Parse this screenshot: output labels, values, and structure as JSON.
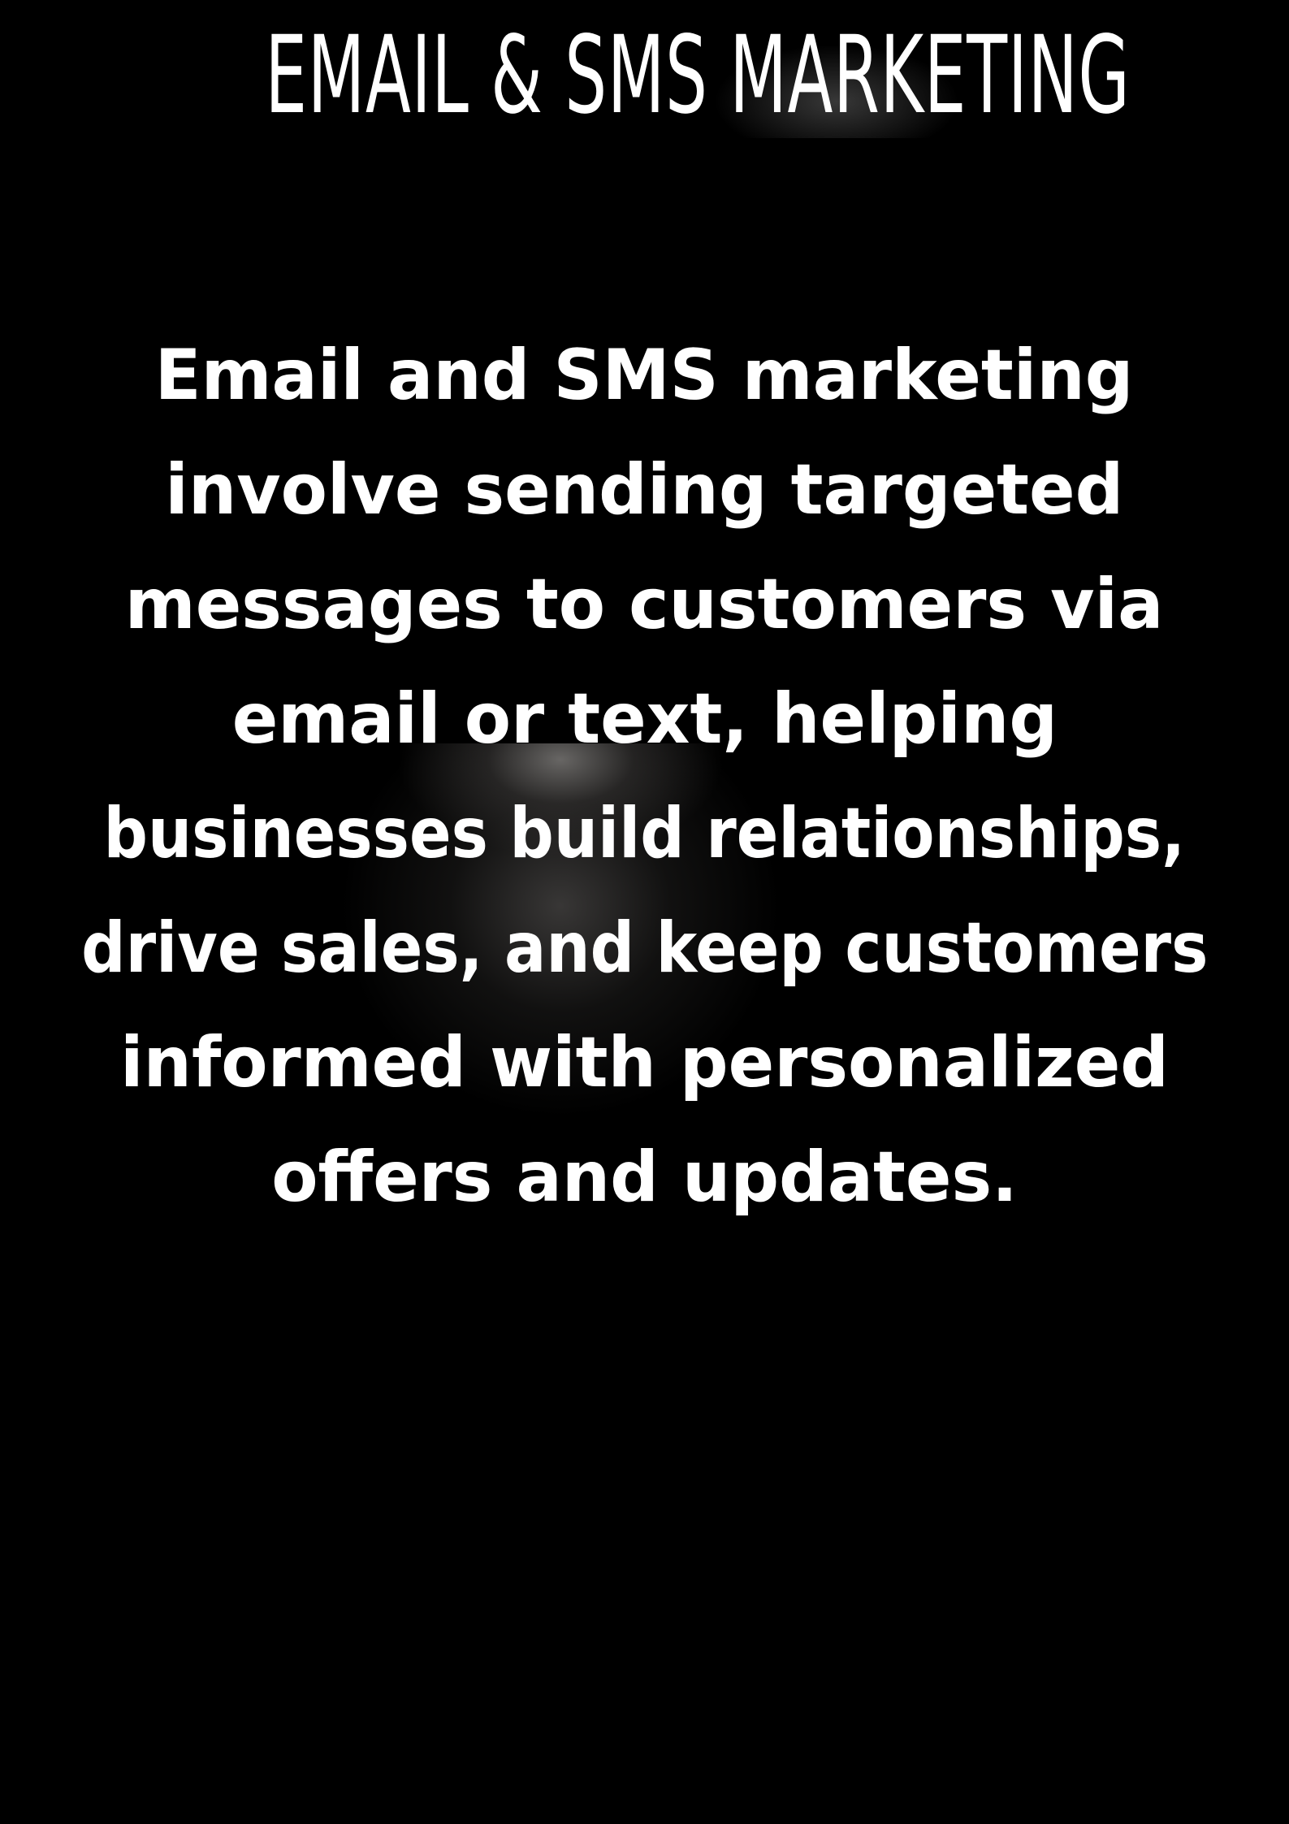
{
  "heading": "EMAIL & SMS MARKETING",
  "description_lines": [
    "Email and SMS marketing",
    "involve sending targeted",
    "messages to customers via",
    "email or text, helping",
    "businesses build relationships,",
    "drive sales, and keep customers",
    "informed with personalized",
    "offers and updates."
  ],
  "colors": {
    "background": "#000000",
    "text": "#ffffff",
    "glow": "#4b4948"
  }
}
